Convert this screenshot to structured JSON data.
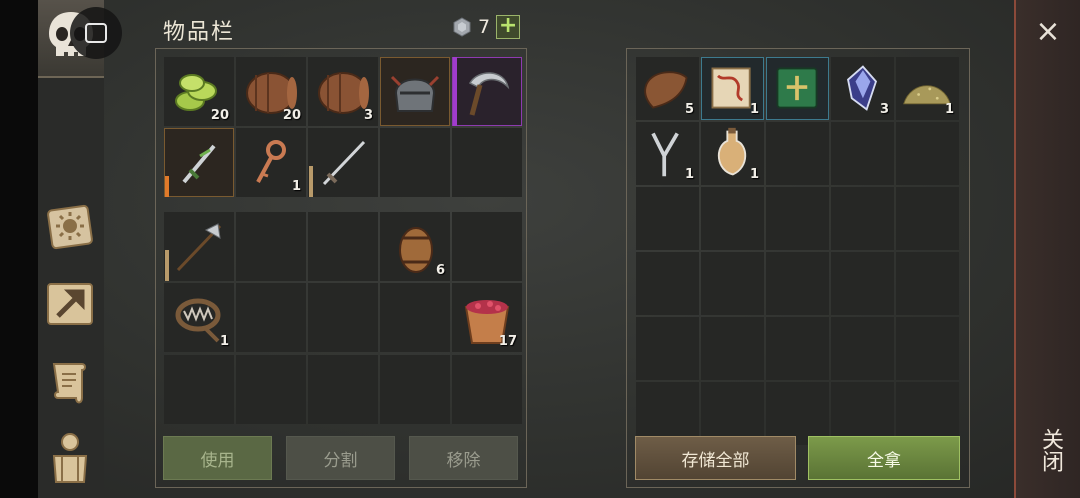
{
  "inventory": {
    "title": "物品栏",
    "currency_count": "7",
    "plus_label": "+",
    "slots": [
      {
        "item": "lime-slices-icon",
        "qty": "20",
        "rarity": ""
      },
      {
        "item": "barrel-icon",
        "qty": "20",
        "rarity": ""
      },
      {
        "item": "barrel-icon",
        "qty": "3",
        "rarity": ""
      },
      {
        "item": "helmet-icon",
        "qty": "",
        "rarity": "gold"
      },
      {
        "item": "sickle-icon",
        "qty": "",
        "rarity": "purple"
      },
      {
        "item": "dagger-icon",
        "qty": "",
        "rarity": "gold-bar"
      },
      {
        "item": "key-icon",
        "qty": "1",
        "rarity": ""
      },
      {
        "item": "sword-icon",
        "qty": "",
        "rarity": "tan-bar"
      },
      {
        "item": "",
        "qty": "",
        "rarity": ""
      },
      {
        "item": "",
        "qty": "",
        "rarity": ""
      }
    ],
    "slots2": [
      {
        "item": "halberd-icon",
        "qty": "",
        "rarity": "tan-bar"
      },
      {
        "item": "",
        "qty": "",
        "rarity": ""
      },
      {
        "item": "",
        "qty": "",
        "rarity": ""
      },
      {
        "item": "small-barrel-icon",
        "qty": "6",
        "rarity": ""
      },
      {
        "item": "",
        "qty": "",
        "rarity": ""
      },
      {
        "item": "bear-trap-icon",
        "qty": "1",
        "rarity": ""
      },
      {
        "item": "",
        "qty": "",
        "rarity": ""
      },
      {
        "item": "",
        "qty": "",
        "rarity": ""
      },
      {
        "item": "",
        "qty": "",
        "rarity": ""
      },
      {
        "item": "berry-bucket-icon",
        "qty": "17",
        "rarity": ""
      }
    ],
    "use_label": "使用",
    "split_label": "分割",
    "remove_label": "移除"
  },
  "container": {
    "slots": [
      {
        "item": "leather-icon",
        "qty": "5",
        "rarity": ""
      },
      {
        "item": "map-scroll-icon",
        "qty": "1",
        "rarity": "blue"
      },
      {
        "item": "green-book-icon",
        "qty": "",
        "rarity": "blue"
      },
      {
        "item": "crystal-icon",
        "qty": "3",
        "rarity": ""
      },
      {
        "item": "sand-pile-icon",
        "qty": "1",
        "rarity": ""
      },
      {
        "item": "slingshot-icon",
        "qty": "1",
        "rarity": ""
      },
      {
        "item": "potion-icon",
        "qty": "1",
        "rarity": ""
      }
    ],
    "store_all_label": "存储全部",
    "take_all_label": "全拿"
  },
  "close_label": "关闭",
  "close_icon": "×"
}
